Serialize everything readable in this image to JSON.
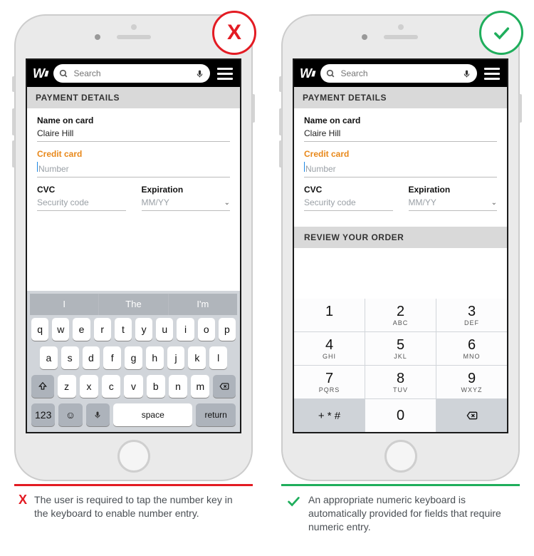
{
  "badges": {
    "bad": "X",
    "good": "✓"
  },
  "app": {
    "logo": "W",
    "search_placeholder": "Search"
  },
  "section_title": "PAYMENT DETAILS",
  "review_title": "REVIEW YOUR ORDER",
  "form": {
    "name_label": "Name on card",
    "name_value": "Claire Hill",
    "card_label": "Credit card",
    "card_placeholder": "Number",
    "cvc_label": "CVC",
    "cvc_placeholder": "Security code",
    "exp_label": "Expiration",
    "exp_placeholder": "MM/YY"
  },
  "qwerty": {
    "suggestions": [
      "I",
      "The",
      "I'm"
    ],
    "row1": [
      "q",
      "w",
      "e",
      "r",
      "t",
      "y",
      "u",
      "i",
      "o",
      "p"
    ],
    "row2": [
      "a",
      "s",
      "d",
      "f",
      "g",
      "h",
      "j",
      "k",
      "l"
    ],
    "row3": [
      "z",
      "x",
      "c",
      "v",
      "b",
      "n",
      "m"
    ],
    "num_key": "123",
    "space_key": "space",
    "return_key": "return"
  },
  "numpad": {
    "keys": [
      {
        "digit": "1",
        "letters": ""
      },
      {
        "digit": "2",
        "letters": "ABC"
      },
      {
        "digit": "3",
        "letters": "DEF"
      },
      {
        "digit": "4",
        "letters": "GHI"
      },
      {
        "digit": "5",
        "letters": "JKL"
      },
      {
        "digit": "6",
        "letters": "MNO"
      },
      {
        "digit": "7",
        "letters": "PQRS"
      },
      {
        "digit": "8",
        "letters": "TUV"
      },
      {
        "digit": "9",
        "letters": "WXYZ"
      }
    ],
    "symbol_key": "+ * #",
    "zero": "0"
  },
  "captions": {
    "bad": "The user is required to tap the number key in the keyboard to enable number entry.",
    "good": "An appropriate numeric keyboard is automatically provided for fields that require numeric entry."
  }
}
